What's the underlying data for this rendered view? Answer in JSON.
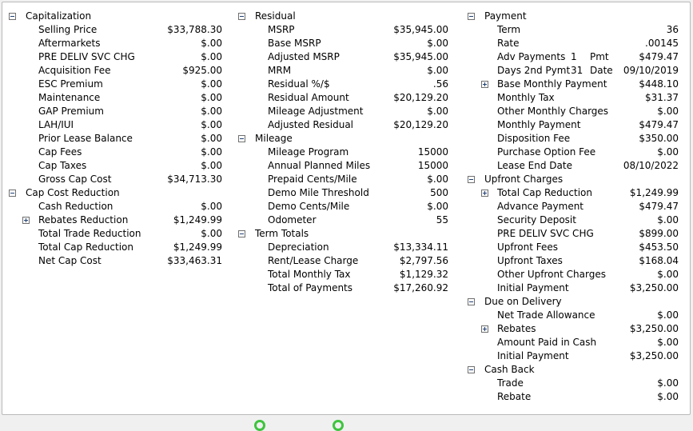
{
  "columns": [
    [
      {
        "type": "header",
        "label": "Capitalization",
        "toggle": "minus"
      },
      {
        "type": "item",
        "label": "Selling Price",
        "value": "$33,788.30"
      },
      {
        "type": "item",
        "label": "Aftermarkets",
        "value": "$.00"
      },
      {
        "type": "item",
        "label": "PRE DELIV SVC CHG",
        "value": "$.00"
      },
      {
        "type": "item",
        "label": "Acquisition Fee",
        "value": "$925.00"
      },
      {
        "type": "item",
        "label": "ESC Premium",
        "value": "$.00"
      },
      {
        "type": "item",
        "label": "Maintenance",
        "value": "$.00"
      },
      {
        "type": "item",
        "label": "GAP Premium",
        "value": "$.00"
      },
      {
        "type": "item",
        "label": "LAH/IUI",
        "value": "$.00"
      },
      {
        "type": "item",
        "label": "Prior Lease Balance",
        "value": "$.00"
      },
      {
        "type": "item",
        "label": "Cap Fees",
        "value": "$.00"
      },
      {
        "type": "item",
        "label": "Cap Taxes",
        "value": "$.00"
      },
      {
        "type": "item",
        "label": "Gross Cap Cost",
        "value": "$34,713.30"
      },
      {
        "type": "header",
        "label": "Cap Cost Reduction",
        "toggle": "minus"
      },
      {
        "type": "item",
        "label": "Cash Reduction",
        "value": "$.00"
      },
      {
        "type": "item",
        "label": "Rebates Reduction",
        "value": "$1,249.99",
        "toggle": "plus"
      },
      {
        "type": "item",
        "label": "Total Trade Reduction",
        "value": "$.00"
      },
      {
        "type": "item",
        "label": "Total Cap Reduction",
        "value": "$1,249.99"
      },
      {
        "type": "item",
        "label": "Net Cap Cost",
        "value": "$33,463.31"
      }
    ],
    [
      {
        "type": "header",
        "label": "Residual",
        "toggle": "minus"
      },
      {
        "type": "item",
        "label": "MSRP",
        "value": "$35,945.00"
      },
      {
        "type": "item",
        "label": "Base MSRP",
        "value": "$.00"
      },
      {
        "type": "item",
        "label": "Adjusted MSRP",
        "value": "$35,945.00"
      },
      {
        "type": "item",
        "label": "MRM",
        "value": "$.00"
      },
      {
        "type": "item",
        "label": "Residual %/$",
        "value": ".56"
      },
      {
        "type": "item",
        "label": "Residual Amount",
        "value": "$20,129.20"
      },
      {
        "type": "item",
        "label": "Mileage Adjustment",
        "value": "$.00"
      },
      {
        "type": "item",
        "label": "Adjusted Residual",
        "value": "$20,129.20"
      },
      {
        "type": "header",
        "label": "Mileage",
        "toggle": "minus"
      },
      {
        "type": "item",
        "label": "Mileage Program",
        "value": "15000"
      },
      {
        "type": "item",
        "label": "Annual Planned Miles",
        "value": "15000"
      },
      {
        "type": "item",
        "label": "Prepaid Cents/Mile",
        "value": "$.00"
      },
      {
        "type": "item",
        "label": "Demo Mile Threshold",
        "value": "500"
      },
      {
        "type": "item",
        "label": "Demo Cents/Mile",
        "value": "$.00"
      },
      {
        "type": "item",
        "label": "Odometer",
        "value": "55"
      },
      {
        "type": "header",
        "label": "Term Totals",
        "toggle": "minus"
      },
      {
        "type": "item",
        "label": "Depreciation",
        "value": "$13,334.11"
      },
      {
        "type": "item",
        "label": "Rent/Lease Charge",
        "value": "$2,797.56"
      },
      {
        "type": "item",
        "label": "Total Monthly Tax",
        "value": "$1,129.32"
      },
      {
        "type": "item",
        "label": "Total of Payments",
        "value": "$17,260.92"
      }
    ],
    [
      {
        "type": "header",
        "label": "Payment",
        "toggle": "minus"
      },
      {
        "type": "item",
        "label": "Term",
        "value": "36"
      },
      {
        "type": "item",
        "label": "Rate",
        "value": ".00145"
      },
      {
        "type": "item",
        "label": "Adv Payments",
        "mid_value": "1",
        "mid_label": "Pmt",
        "value": "$479.47"
      },
      {
        "type": "item",
        "label": "Days 2nd Pymt",
        "mid_value": "31",
        "mid_label": "Date",
        "value": "09/10/2019"
      },
      {
        "type": "item",
        "label": "Base Monthly Payment",
        "value": "$448.10",
        "toggle": "plus"
      },
      {
        "type": "item",
        "label": "Monthly Tax",
        "value": "$31.37"
      },
      {
        "type": "item",
        "label": "Other Monthly Charges",
        "value": "$.00"
      },
      {
        "type": "item",
        "label": "Monthly Payment",
        "value": "$479.47"
      },
      {
        "type": "item",
        "label": "Disposition Fee",
        "value": "$350.00"
      },
      {
        "type": "item",
        "label": "Purchase Option Fee",
        "value": "$.00"
      },
      {
        "type": "item",
        "label": "Lease End Date",
        "value": "08/10/2022"
      },
      {
        "type": "header",
        "label": "Upfront Charges",
        "toggle": "minus"
      },
      {
        "type": "item",
        "label": "Total Cap Reduction",
        "value": "$1,249.99",
        "toggle": "plus"
      },
      {
        "type": "item",
        "label": "Advance Payment",
        "value": "$479.47"
      },
      {
        "type": "item",
        "label": "Security Deposit",
        "value": "$.00"
      },
      {
        "type": "item",
        "label": "PRE DELIV SVC CHG",
        "value": "$899.00"
      },
      {
        "type": "item",
        "label": "Upfront Fees",
        "value": "$453.50"
      },
      {
        "type": "item",
        "label": "Upfront Taxes",
        "value": "$168.04"
      },
      {
        "type": "item",
        "label": "Other Upfront Charges",
        "value": "$.00"
      },
      {
        "type": "item",
        "label": "Initial Payment",
        "value": "$3,250.00"
      },
      {
        "type": "header",
        "label": "Due on Delivery",
        "toggle": "minus"
      },
      {
        "type": "item",
        "label": "Net Trade Allowance",
        "value": "$.00"
      },
      {
        "type": "item",
        "label": "Rebates",
        "value": "$3,250.00",
        "toggle": "plus"
      },
      {
        "type": "item",
        "label": "Amount Paid in Cash",
        "value": "$.00"
      },
      {
        "type": "item",
        "label": "Initial Payment",
        "value": "$3,250.00"
      },
      {
        "type": "header",
        "label": "Cash Back",
        "toggle": "minus"
      },
      {
        "type": "item",
        "label": "Trade",
        "value": "$.00"
      },
      {
        "type": "item",
        "label": "Rebate",
        "value": "$.00"
      }
    ]
  ]
}
